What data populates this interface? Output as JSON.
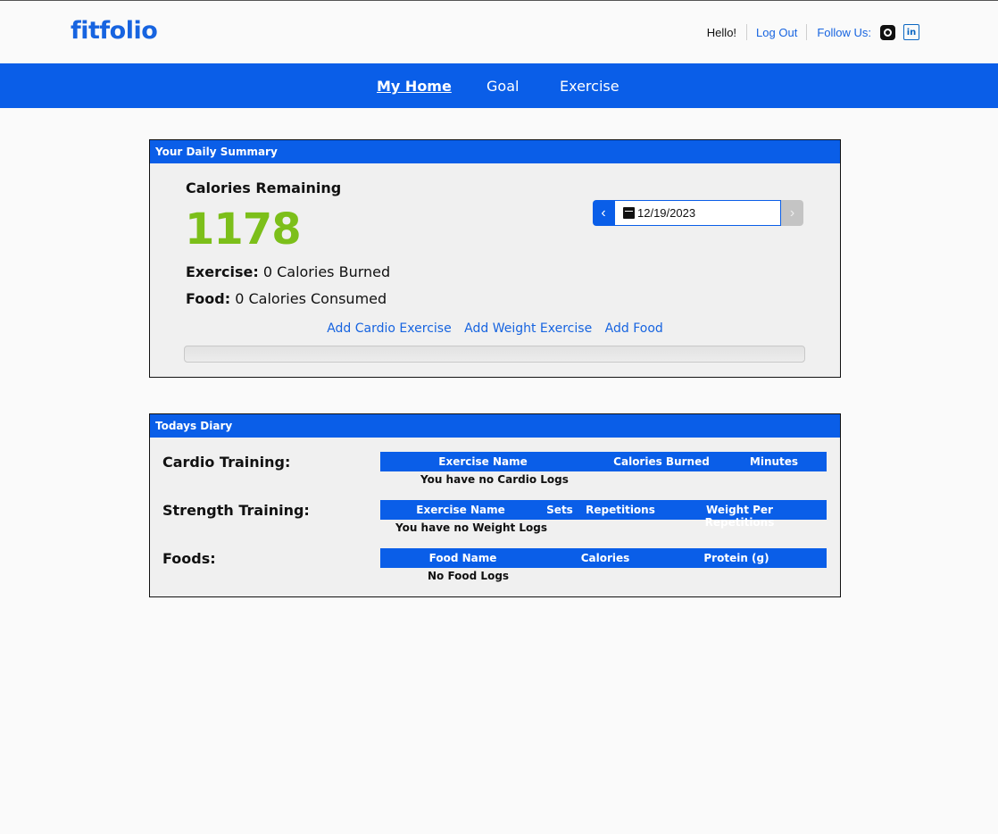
{
  "header": {
    "logo": "fitfolio",
    "greeting": "Hello!",
    "logout_label": "Log Out",
    "follow_label": "Follow Us:",
    "icons": [
      "github-icon",
      "linkedin-icon"
    ]
  },
  "nav": {
    "items": [
      {
        "label": "My Home",
        "active": true
      },
      {
        "label": "Goal",
        "active": false
      },
      {
        "label": "Exercise",
        "active": false
      }
    ]
  },
  "summary": {
    "title": "Your Daily Summary",
    "calories_label": "Calories Remaining",
    "calories_value": "1178",
    "exercise_label": "Exercise:",
    "exercise_value": "0 Calories Burned",
    "food_label": "Food:",
    "food_value": "0 Calories Consumed",
    "date": "12/19/2023",
    "links": [
      "Add Cardio Exercise",
      "Add Weight Exercise",
      "Add Food"
    ]
  },
  "diary": {
    "title": "Todays Diary",
    "cardio": {
      "label": "Cardio Training:",
      "columns": [
        "Exercise Name",
        "Calories Burned",
        "Minutes"
      ],
      "empty": "You have no Cardio Logs"
    },
    "strength": {
      "label": "Strength Training:",
      "columns": [
        "Exercise Name",
        "Sets",
        "Repetitions",
        "Weight Per Repetitions"
      ],
      "empty": "You have no Weight Logs"
    },
    "foods": {
      "label": "Foods:",
      "columns": [
        "Food Name",
        "Calories",
        "Protein (g)"
      ],
      "empty": "No Food Logs"
    }
  },
  "colors": {
    "brand": "#1764e0",
    "nav_bg": "#0a5ee8",
    "calories_green": "#7cbf1a"
  }
}
